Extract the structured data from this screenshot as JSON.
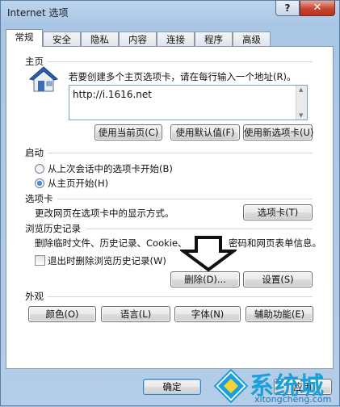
{
  "window": {
    "title": "Internet 选项",
    "help": "?",
    "close": "✕"
  },
  "tabs": [
    {
      "label": "常规",
      "active": true
    },
    {
      "label": "安全"
    },
    {
      "label": "隐私"
    },
    {
      "label": "内容"
    },
    {
      "label": "连接"
    },
    {
      "label": "程序"
    },
    {
      "label": "高级"
    }
  ],
  "home": {
    "heading": "主页",
    "description": "若要创建多个主页选项卡，请在每行输入一个地址(R)。",
    "url": "http://i.1616.net",
    "buttons": [
      "使用当前页(C)",
      "使用默认值(F)",
      "使用新选项卡(U)"
    ]
  },
  "startup": {
    "heading": "启动",
    "options": [
      {
        "label": "从上次会话中的选项卡开始(B)",
        "checked": false
      },
      {
        "label": "从主页开始(H)",
        "checked": true
      }
    ]
  },
  "tabs_section": {
    "heading": "选项卡",
    "description": "更改网页在选项卡中的显示方式。",
    "button": "选项卡(T)"
  },
  "history": {
    "heading": "浏览历史记录",
    "description_left": "删除临时文件、历史记录、Cookie、",
    "description_right": "密码和网页表单信息。",
    "checkbox": "退出时删除浏览历史记录(W)",
    "delete": "删除(D)...",
    "settings": "设置(S)"
  },
  "appearance": {
    "heading": "外观",
    "buttons": [
      "颜色(O)",
      "语言(L)",
      "字体(N)",
      "辅助功能(E)"
    ]
  },
  "footer": {
    "ok": "确定",
    "apply": "应用"
  },
  "watermark": {
    "brand": "系统城",
    "url": "xitongcheng.com"
  },
  "colors": {
    "accent": "#1a9fd8",
    "titlebar": "#a9c6e5",
    "close": "#c8452f"
  }
}
